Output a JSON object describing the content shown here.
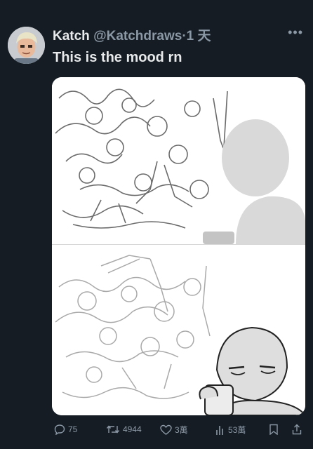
{
  "tweet": {
    "author_name": "Katch",
    "author_handle": "@Katchdraws",
    "separator": "·",
    "time": "1 天",
    "text": "This is the mood rn"
  },
  "actions": {
    "replies": "75",
    "retweets": "4944",
    "likes": "3萬",
    "views": "53萬"
  },
  "colors": {
    "background": "#151c24",
    "text": "#e7e9ea",
    "muted": "#8b98a5"
  }
}
